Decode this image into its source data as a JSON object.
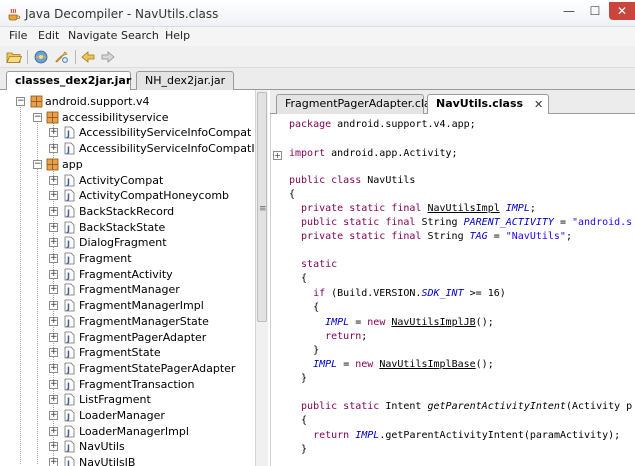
{
  "window": {
    "title": "Java Decompiler - NavUtils.class",
    "controls": {
      "minimize": "—",
      "maximize": "☐",
      "close": "✕"
    }
  },
  "menu": [
    "File",
    "Edit",
    "Navigate",
    "Search",
    "Help"
  ],
  "toolbar": {
    "buttons": [
      "open-icon",
      "open-type-icon",
      "search-icon",
      "back-arrow-icon",
      "forward-arrow-icon"
    ]
  },
  "main_tabs": [
    {
      "label": "classes_dex2jar.jar",
      "active": true
    },
    {
      "label": "NH_dex2jar.jar",
      "active": false
    }
  ],
  "tree": [
    {
      "label": "android.support.v4",
      "depth": 0,
      "icon": "package-icon",
      "toggle": "−"
    },
    {
      "label": "accessibilityservice",
      "depth": 1,
      "icon": "package-icon",
      "toggle": "−"
    },
    {
      "label": "AccessibilityServiceInfoCompat",
      "depth": 2,
      "icon": "java-file-icon",
      "toggle": "+"
    },
    {
      "label": "AccessibilityServiceInfoCompatIcs",
      "depth": 2,
      "icon": "java-file-icon",
      "toggle": "+"
    },
    {
      "label": "app",
      "depth": 1,
      "icon": "package-icon",
      "toggle": "−"
    },
    {
      "label": "ActivityCompat",
      "depth": 2,
      "icon": "java-file-icon",
      "toggle": "+"
    },
    {
      "label": "ActivityCompatHoneycomb",
      "depth": 2,
      "icon": "java-file-icon",
      "toggle": "+"
    },
    {
      "label": "BackStackRecord",
      "depth": 2,
      "icon": "java-file-icon",
      "toggle": "+"
    },
    {
      "label": "BackStackState",
      "depth": 2,
      "icon": "java-file-icon",
      "toggle": "+"
    },
    {
      "label": "DialogFragment",
      "depth": 2,
      "icon": "java-file-icon",
      "toggle": "+"
    },
    {
      "label": "Fragment",
      "depth": 2,
      "icon": "java-file-icon",
      "toggle": "+"
    },
    {
      "label": "FragmentActivity",
      "depth": 2,
      "icon": "java-file-icon",
      "toggle": "+"
    },
    {
      "label": "FragmentManager",
      "depth": 2,
      "icon": "java-file-icon",
      "toggle": "+"
    },
    {
      "label": "FragmentManagerImpl",
      "depth": 2,
      "icon": "java-file-icon",
      "toggle": "+"
    },
    {
      "label": "FragmentManagerState",
      "depth": 2,
      "icon": "java-file-icon",
      "toggle": "+"
    },
    {
      "label": "FragmentPagerAdapter",
      "depth": 2,
      "icon": "java-file-icon",
      "toggle": "+"
    },
    {
      "label": "FragmentState",
      "depth": 2,
      "icon": "java-file-icon",
      "toggle": "+"
    },
    {
      "label": "FragmentStatePagerAdapter",
      "depth": 2,
      "icon": "java-file-icon",
      "toggle": "+"
    },
    {
      "label": "FragmentTransaction",
      "depth": 2,
      "icon": "java-file-icon",
      "toggle": "+"
    },
    {
      "label": "ListFragment",
      "depth": 2,
      "icon": "java-file-icon",
      "toggle": "+"
    },
    {
      "label": "LoaderManager",
      "depth": 2,
      "icon": "java-file-icon",
      "toggle": "+"
    },
    {
      "label": "LoaderManagerImpl",
      "depth": 2,
      "icon": "java-file-icon",
      "toggle": "+"
    },
    {
      "label": "NavUtils",
      "depth": 2,
      "icon": "java-file-icon",
      "toggle": "+"
    },
    {
      "label": "NavUtilsJB",
      "depth": 2,
      "icon": "java-file-icon",
      "toggle": "+"
    }
  ],
  "editor_tabs": [
    {
      "label": "FragmentPagerAdapter.class",
      "active": false
    },
    {
      "label": "NavUtils.class",
      "active": true,
      "close": "✕"
    }
  ],
  "code": {
    "l1": {
      "kw": "package",
      "rest": " android.support.v4.app;"
    },
    "l2": {
      "kw": "import",
      "rest": " android.app.Activity;",
      "fold": "+"
    },
    "l3": {
      "kw": "public class",
      "rest": " NavUtils"
    },
    "l4": "{",
    "l5": {
      "kw": "  private static final",
      "type": "NavUtilsImpl",
      "field": "IMPL",
      "end": ";"
    },
    "l6": {
      "kw": "  public static final",
      "type": " String ",
      "field": "PARENT_ACTIVITY",
      "eq": " = ",
      "str": "\"android.s"
    },
    "l7": {
      "kw": "  private static final",
      "type": " String ",
      "field": "TAG",
      "eq": " = ",
      "str": "\"NavUtils\"",
      "end": ";"
    },
    "l8": {
      "kw": "  static"
    },
    "l9": "  {",
    "l10": {
      "kw": "    if",
      "pre": " (Build.VERSION.",
      "field": "SDK_INT",
      "post": " >= 16)"
    },
    "l11": "    {",
    "l12": {
      "field": "      IMPL",
      "eq": " = ",
      "kw": "new",
      "type": "NavUtilsImplJB",
      "end": "();"
    },
    "l13": {
      "kw": "      return",
      "end": ";"
    },
    "l14": "    }",
    "l15": {
      "field": "    IMPL",
      "eq": " = ",
      "kw": "new",
      "type": "NavUtilsImplBase",
      "end": "();"
    },
    "l16": "  }",
    "l17": {
      "kw": "  public static",
      "type": " Intent ",
      "method": "getParentActivityIntent",
      "rest": "(Activity p"
    },
    "l18": "  {",
    "l19": {
      "kw": "    return",
      "field": "IMPL",
      "rest": ".getParentActivityIntent(paramActivity);"
    },
    "l20": "  }"
  }
}
